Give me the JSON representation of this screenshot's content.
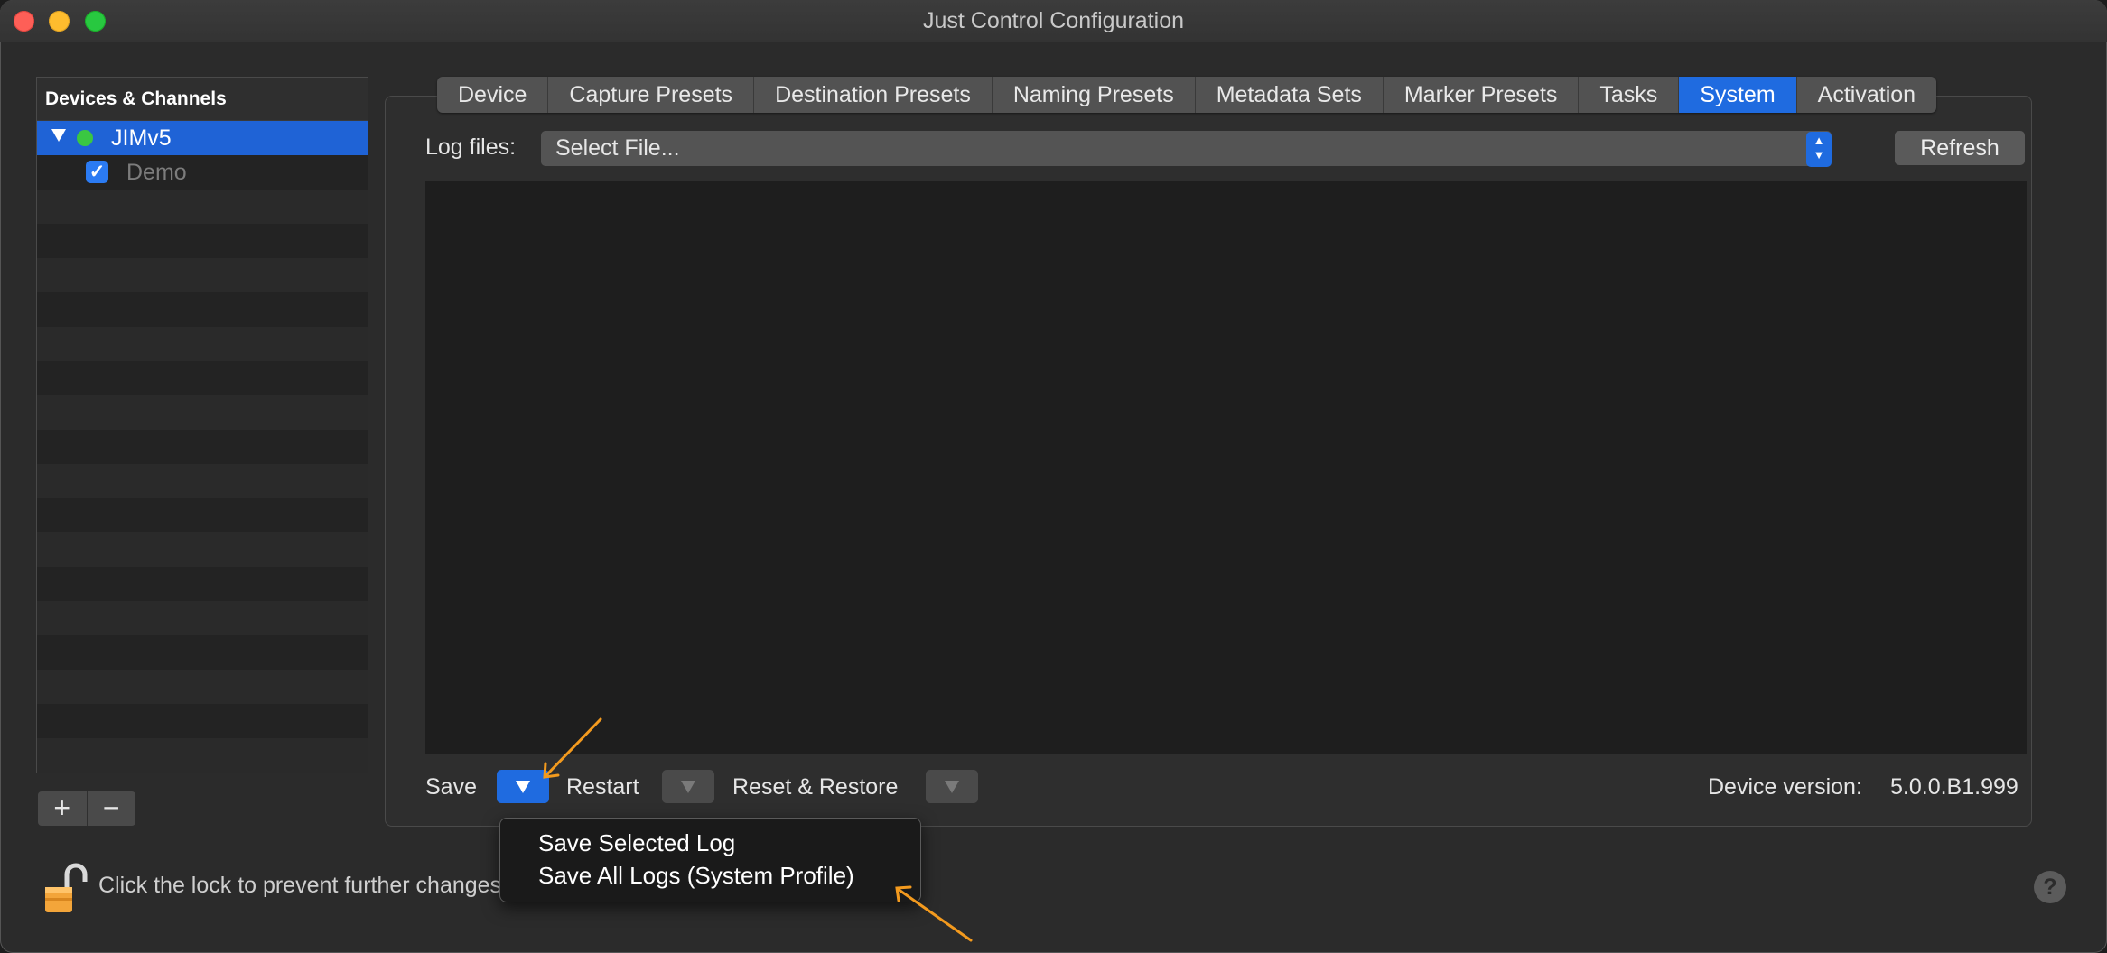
{
  "window": {
    "title": "Just Control Configuration"
  },
  "sidebar": {
    "header": "Devices & Channels",
    "device": {
      "label": "JIMv5",
      "status": "online"
    },
    "channel": {
      "label": "Demo",
      "checked": true
    },
    "add_label": "+",
    "remove_label": "−"
  },
  "tabs": [
    "Device",
    "Capture Presets",
    "Destination Presets",
    "Naming Presets",
    "Metadata Sets",
    "Marker Presets",
    "Tasks",
    "System",
    "Activation"
  ],
  "active_tab": "System",
  "log": {
    "label": "Log files:",
    "select_value": "Select File...",
    "refresh_label": "Refresh"
  },
  "actions": {
    "save_label": "Save",
    "restart_label": "Restart",
    "reset_label": "Reset & Restore"
  },
  "device_version": {
    "label": "Device version:",
    "value": "5.0.0.B1.999"
  },
  "menu": {
    "items": [
      "Save Selected Log",
      "Save All Logs (System Profile)"
    ]
  },
  "lock": {
    "text": "Click the lock to prevent further changes."
  },
  "help_label": "?",
  "colors": {
    "accent": "#1f6be0",
    "annotation": "#f39a1e",
    "online": "#3ac742"
  }
}
